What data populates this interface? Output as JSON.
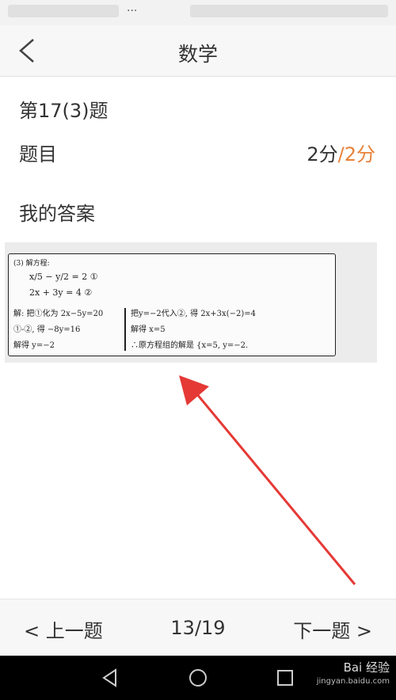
{
  "header": {
    "title": "数学"
  },
  "question": {
    "number": "第17(3)题",
    "label": "题目",
    "score_got": "2分",
    "score_sep": "/",
    "score_total": "2分",
    "answer_label": "我的答案"
  },
  "answer_image": {
    "heading": "(3) 解方程:",
    "eq1": "x/5 − y/2 = 2 ①",
    "eq2": "2x + 3y = 4 ②",
    "left_col": [
      "解: 把①化为 2x−5y=20",
      "①-②, 得   −8y=16",
      "解得          y=−2"
    ],
    "right_col": [
      "把y=−2代入②, 得 2x+3x(−2)=4",
      "解得              x=5",
      "∴原方程组的解是 {x=5, y=−2."
    ]
  },
  "nav": {
    "prev": "< 上一题",
    "page": "13/19",
    "next": "下一题 >"
  },
  "watermark": {
    "brand": "Bai 经验",
    "url": "jingyan.baidu.com"
  },
  "colors": {
    "accent": "#e8823a",
    "arrow": "#e53935"
  }
}
